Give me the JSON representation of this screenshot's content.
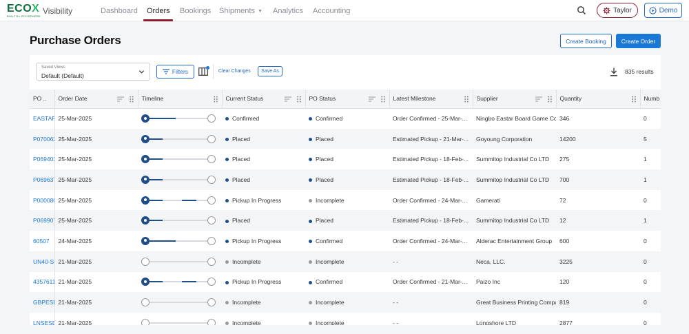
{
  "nav": {
    "logo": "ECOX",
    "logo_sub": "BUILT BY ECOSPHERE",
    "product": "Visibility",
    "tabs": [
      {
        "label": "Dashboard"
      },
      {
        "label": "Orders"
      },
      {
        "label": "Bookings"
      },
      {
        "label": "Shipments"
      },
      {
        "label": "Analytics"
      },
      {
        "label": "Accounting"
      }
    ],
    "active_tab": "Orders",
    "user": "Taylor",
    "demo": "Demo",
    "colors": {
      "accent": "#8b1c2f",
      "primary": "#1a78d6"
    }
  },
  "page": {
    "title": "Purchase Orders",
    "create_booking": "Create Booking",
    "create_order": "Create Order"
  },
  "toolbar": {
    "saved_views_label": "Saved Views",
    "saved_views_value": "Default (Default)",
    "filters": "Filters",
    "clear_changes": "Clear Changes",
    "save_as": "Save As",
    "results": "835 results"
  },
  "table": {
    "columns": [
      "PO ..",
      "Order Date",
      "Timeline",
      "Current Status",
      "PO Status",
      "Latest Milestone",
      "Supplier",
      "Quantity",
      "Numb"
    ],
    "rows": [
      {
        "po": "EASTARS",
        "date": "25-Mar-2025",
        "progress": [
          0.46
        ],
        "status": "Confirmed",
        "status_dot": "blue",
        "po_status": "Confirmed",
        "po_dot": "blue",
        "milestone": "Order Confirmed - 25-Mar-...",
        "supplier": "Ningbo Eastar Board Game Co",
        "qty": "346",
        "num": "0"
      },
      {
        "po": "P070062",
        "date": "25-Mar-2025",
        "progress": [
          0.26
        ],
        "status": "Placed",
        "status_dot": "blue",
        "po_status": "Placed",
        "po_dot": "blue",
        "milestone": "Estimated Pickup - 21-Mar-...",
        "supplier": "Goyoung Corporation",
        "qty": "14200",
        "num": "5"
      },
      {
        "po": "P069403",
        "date": "25-Mar-2025",
        "progress": [
          0.26
        ],
        "status": "Placed",
        "status_dot": "blue",
        "po_status": "Placed",
        "po_dot": "blue",
        "milestone": "Estimated Pickup - 18-Feb-...",
        "supplier": "Summitop Industrial Co LTD",
        "qty": "275",
        "num": "1"
      },
      {
        "po": "P069637",
        "date": "25-Mar-2025",
        "progress": [
          0.26
        ],
        "status": "Placed",
        "status_dot": "blue",
        "po_status": "Placed",
        "po_dot": "blue",
        "milestone": "Estimated Pickup - 18-Feb-...",
        "supplier": "Summitop Industrial Co LTD",
        "qty": "700",
        "num": "1"
      },
      {
        "po": "P000080",
        "date": "25-Mar-2025",
        "progress": [
          0.26,
          0.55,
          0.77
        ],
        "status": "Pickup In Progress",
        "status_dot": "blue",
        "po_status": "Incomplete",
        "po_dot": "grey",
        "milestone": "Order Confirmed - 24-Mar-...",
        "supplier": "Gamerati",
        "qty": "72",
        "num": "0"
      },
      {
        "po": "P069907",
        "date": "25-Mar-2025",
        "progress": [
          0.26
        ],
        "status": "Placed",
        "status_dot": "blue",
        "po_status": "Placed",
        "po_dot": "blue",
        "milestone": "Estimated Pickup - 18-Feb-...",
        "supplier": "Summitop Industrial Co LTD",
        "qty": "12",
        "num": "1"
      },
      {
        "po": "60507",
        "date": "24-Mar-2025",
        "progress": [
          0.46
        ],
        "status": "Pickup In Progress",
        "status_dot": "blue",
        "po_status": "Confirmed",
        "po_dot": "blue",
        "milestone": "Order Confirmed - 24-Mar-...",
        "supplier": "Alderac Entertainment Group",
        "qty": "600",
        "num": "0"
      },
      {
        "po": "UN40-SC",
        "date": "21-Mar-2025",
        "progress": [],
        "status": "Incomplete",
        "status_dot": "grey",
        "po_status": "Incomplete",
        "po_dot": "grey",
        "milestone": "- -",
        "supplier": "Neca, LLC.",
        "qty": "3225",
        "num": "0"
      },
      {
        "po": "4357611",
        "date": "21-Mar-2025",
        "progress": [
          0.26,
          0.55,
          0.77
        ],
        "status": "Pickup In Progress",
        "status_dot": "blue",
        "po_status": "Confirmed",
        "po_dot": "blue",
        "milestone": "Order Confirmed - 21-Mar-...",
        "supplier": "Paizo Inc",
        "qty": "120",
        "num": "0"
      },
      {
        "po": "GBPESD",
        "date": "21-Mar-2025",
        "progress": [],
        "status": "Incomplete",
        "status_dot": "grey",
        "po_status": "Incomplete",
        "po_dot": "grey",
        "milestone": "- -",
        "supplier": "Great Business Printing Compa",
        "qty": "819",
        "num": "0"
      },
      {
        "po": "LNSESD",
        "date": "21-Mar-2025",
        "progress": [],
        "status": "Incomplete",
        "status_dot": "grey",
        "po_status": "Incomplete",
        "po_dot": "grey",
        "milestone": "- -",
        "supplier": "Longshore LTD",
        "qty": "2877",
        "num": "0"
      }
    ]
  }
}
